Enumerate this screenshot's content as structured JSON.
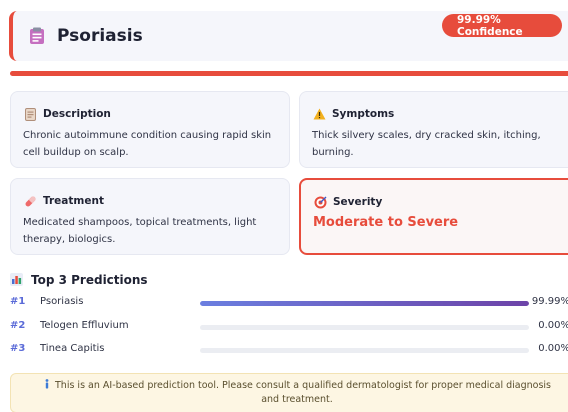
{
  "header": {
    "icon": "clipboard-icon",
    "title": "Psoriasis",
    "confidence": "99.99% Confidence"
  },
  "colors": {
    "accent": "#e74c3c",
    "bar_start": "#6b7fe0",
    "bar_end": "#6d43a8",
    "rank": "#5b6bd8"
  },
  "cards": {
    "description": {
      "icon": "document-icon",
      "title": "Description",
      "text": "Chronic autoimmune condition causing rapid skin cell buildup on scalp."
    },
    "symptoms": {
      "icon": "warning-icon",
      "title": "Symptoms",
      "text": "Thick silvery scales, dry cracked skin, itching, burning."
    },
    "treatment": {
      "icon": "pill-icon",
      "title": "Treatment",
      "text": "Medicated shampoos, topical treatments, light therapy, biologics."
    },
    "severity": {
      "icon": "target-icon",
      "title": "Severity",
      "value": "Moderate to Severe"
    }
  },
  "predictions": {
    "title": "Top 3 Predictions",
    "icon": "bar-chart-icon",
    "items": [
      {
        "rank": "#1",
        "name": "Psoriasis",
        "percent": "99.99%",
        "value": 99.99
      },
      {
        "rank": "#2",
        "name": "Telogen Effluvium",
        "percent": "0.00%",
        "value": 0.0
      },
      {
        "rank": "#3",
        "name": "Tinea Capitis",
        "percent": "0.00%",
        "value": 0.0
      }
    ]
  },
  "disclaimer": {
    "icon": "info-icon",
    "text": "This is an AI-based prediction tool. Please consult a qualified dermatologist for proper medical diagnosis and treatment."
  }
}
